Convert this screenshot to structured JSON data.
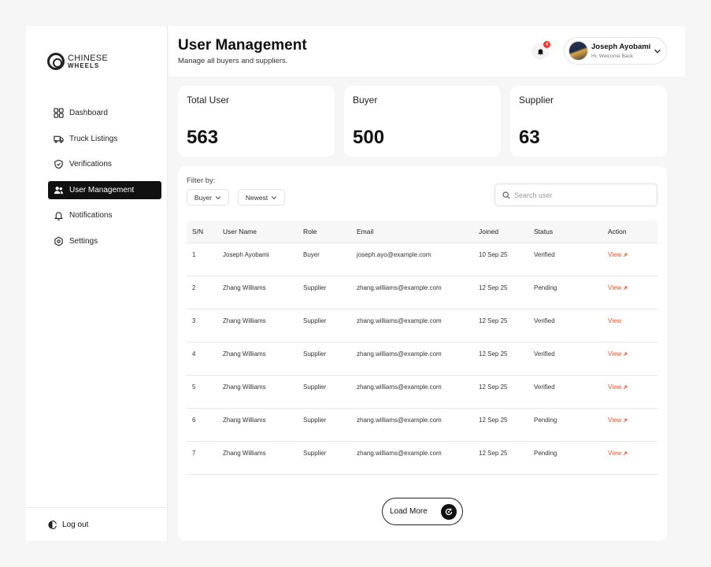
{
  "brand": {
    "line1": "CHINESE",
    "line2": "WHEELS"
  },
  "sidebar": {
    "items": [
      {
        "label": "Dashboard",
        "icon": "grid-icon"
      },
      {
        "label": "Truck Listings",
        "icon": "truck-icon"
      },
      {
        "label": "Verifications",
        "icon": "shield-check-icon"
      },
      {
        "label": "User Management",
        "icon": "users-icon",
        "active": true
      },
      {
        "label": "Notifications",
        "icon": "bell-icon"
      },
      {
        "label": "Settings",
        "icon": "gear-icon"
      }
    ],
    "logout_label": "Log out"
  },
  "header": {
    "title": "User Management",
    "subtitle": "Manage all buyers and suppliers.",
    "notification_count": "4",
    "user_name": "Joseph Ayobami",
    "user_greeting": "Hi, Welcome Back"
  },
  "stats": [
    {
      "label": "Total User",
      "value": "563"
    },
    {
      "label": "Buyer",
      "value": "500"
    },
    {
      "label": "Supplier",
      "value": "63"
    }
  ],
  "filters": {
    "label": "Filter by:",
    "type_selected": "Buyer",
    "sort_selected": "Newest"
  },
  "search": {
    "placeholder": "Search user"
  },
  "table": {
    "columns": [
      "S/N",
      "User Name",
      "Role",
      "Email",
      "Joined",
      "Status",
      "Action"
    ],
    "rows": [
      {
        "sn": "1",
        "name": "Joseph Ayobami",
        "role": "Buyer",
        "email": "joseph.ayo@example.com",
        "joined": "10 Sep 25",
        "status": "Verified",
        "action": "View",
        "arrow": true
      },
      {
        "sn": "2",
        "name": "Zhang Williams",
        "role": "Supplier",
        "email": "zhang.williams@example.com",
        "joined": "12 Sep 25",
        "status": "Pending",
        "action": "View",
        "arrow": true
      },
      {
        "sn": "3",
        "name": "Zhang Williams",
        "role": "Supplier",
        "email": "zhang.williams@example.com",
        "joined": "12 Sep 25",
        "status": "Verified",
        "action": "View",
        "arrow": false
      },
      {
        "sn": "4",
        "name": "Zhang Williams",
        "role": "Supplier",
        "email": "zhang.williams@example.com",
        "joined": "12 Sep 25",
        "status": "Verified",
        "action": "View",
        "arrow": true
      },
      {
        "sn": "5",
        "name": "Zhang Williams",
        "role": "Supplier",
        "email": "zhang.williams@example.com",
        "joined": "12 Sep 25",
        "status": "Verified",
        "action": "View",
        "arrow": true
      },
      {
        "sn": "6",
        "name": "Zhang Williams",
        "role": "Supplier",
        "email": "zhang.williams@example.com",
        "joined": "12 Sep 25",
        "status": "Pending",
        "action": "View",
        "arrow": true
      },
      {
        "sn": "7",
        "name": "Zhang Williams",
        "role": "Supplier",
        "email": "zhang.williams@example.com",
        "joined": "12 Sep 25",
        "status": "Pending",
        "action": "View",
        "arrow": true
      }
    ]
  },
  "load_more_label": "Load More",
  "colors": {
    "accent": "#e4572e",
    "active_nav": "#111111",
    "badge": "#e53935"
  }
}
